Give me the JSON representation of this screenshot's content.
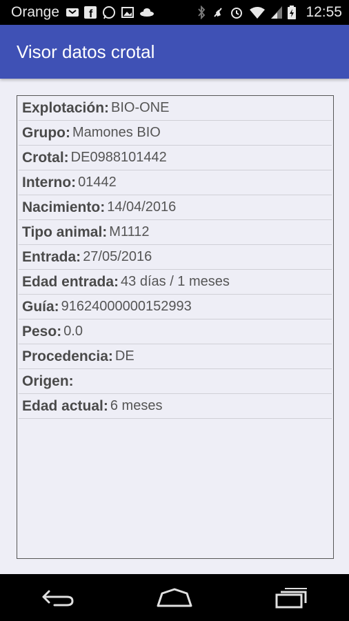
{
  "status_bar": {
    "carrier": "Orange",
    "time": "12:55",
    "icons": [
      "notification-icon",
      "facebook-icon",
      "whatsapp-icon",
      "image-icon",
      "ufo-icon",
      "bluetooth-icon",
      "mute-icon",
      "alarm-icon",
      "wifi-icon",
      "signal-icon",
      "battery-charging-icon"
    ]
  },
  "app_bar": {
    "title": "Visor datos crotal",
    "color": "#3f51b5"
  },
  "details": [
    {
      "label": "Explotación:",
      "value": "BIO-ONE"
    },
    {
      "label": "Grupo:",
      "value": "Mamones BIO"
    },
    {
      "label": "Crotal:",
      "value": "DE0988101442"
    },
    {
      "label": "Interno:",
      "value": "01442"
    },
    {
      "label": "Nacimiento:",
      "value": "14/04/2016"
    },
    {
      "label": "Tipo animal:",
      "value": "M1112"
    },
    {
      "label": "Entrada:",
      "value": "27/05/2016"
    },
    {
      "label": "Edad entrada:",
      "value": "43 días / 1 meses"
    },
    {
      "label": "Guía:",
      "value": "91624000000152993"
    },
    {
      "label": "Peso:",
      "value": "0.0"
    },
    {
      "label": "Procedencia:",
      "value": "DE"
    },
    {
      "label": "Origen:",
      "value": ""
    },
    {
      "label": "Edad actual:",
      "value": "6 meses"
    }
  ],
  "nav_bar": {
    "buttons": [
      "back-icon",
      "home-icon",
      "recents-icon"
    ]
  }
}
